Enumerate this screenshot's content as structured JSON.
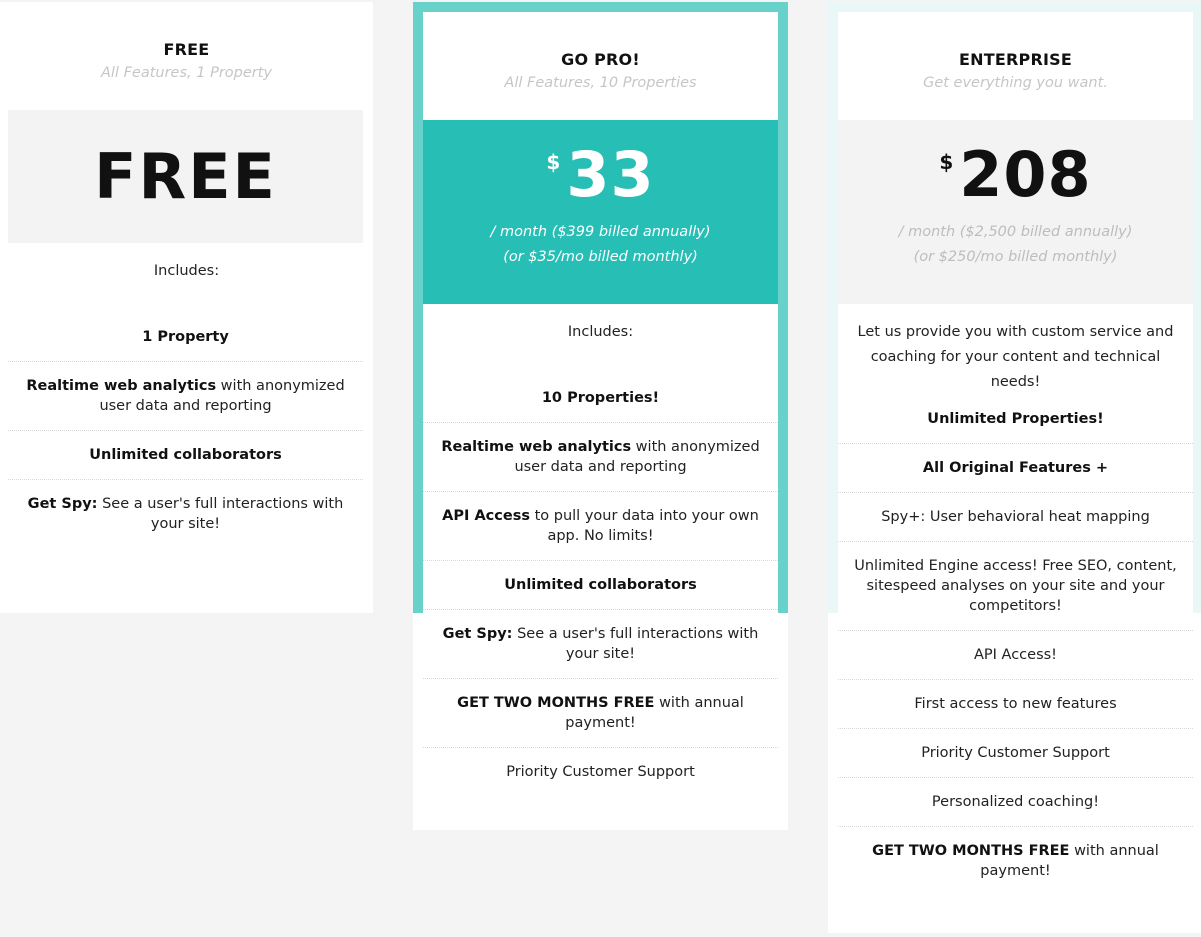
{
  "colors": {
    "page_bg": "#f4f4f4",
    "pro_accent": "#27beb5",
    "pro_border": "#67d1ca",
    "enterprise_border": "#eaf7f8",
    "price_bg": "#f3f3f3"
  },
  "plans": [
    {
      "name": "FREE",
      "tagline": "All Features, 1 Property",
      "price_label": "FREE",
      "includes_label": "Includes:",
      "features": [
        {
          "bold": "1 Property",
          "text": ""
        },
        {
          "bold": "Realtime web analytics",
          "text": " with anonymized user data and reporting"
        },
        {
          "bold": "Unlimited collaborators",
          "text": ""
        },
        {
          "bold": "Get Spy:",
          "text": " See a user's full interactions with your site!"
        }
      ]
    },
    {
      "name": "GO PRO!",
      "tagline": "All Features, 10 Properties",
      "currency": "$",
      "amount": "33",
      "billing_line1": "/ month ($399 billed annually)",
      "billing_line2": "(or $35/mo billed monthly)",
      "includes_label": "Includes:",
      "features": [
        {
          "bold": "10 Properties!",
          "text": ""
        },
        {
          "bold": "Realtime web analytics",
          "text": " with anonymized user data and reporting"
        },
        {
          "bold": "API Access",
          "text": " to pull your data into your own app. No limits!"
        },
        {
          "bold": "Unlimited collaborators",
          "text": ""
        },
        {
          "bold": "Get Spy:",
          "text": " See a user's full interactions with your site!"
        },
        {
          "bold": "GET TWO MONTHS FREE",
          "text": " with annual payment!"
        },
        {
          "bold": "",
          "text": "Priority Customer Support"
        }
      ]
    },
    {
      "name": "ENTERPRISE",
      "tagline": "Get everything you want.",
      "currency": "$",
      "amount": "208",
      "billing_line1": "/ month ($2,500 billed annually)",
      "billing_line2": "(or $250/mo billed monthly)",
      "intro": "Let us provide you with custom service and coaching for your content and technical needs!",
      "features": [
        {
          "bold": "Unlimited Properties!",
          "text": ""
        },
        {
          "bold": "All Original Features +",
          "text": ""
        },
        {
          "bold": "",
          "text": "Spy+: User behavioral heat mapping"
        },
        {
          "bold": "",
          "text": "Unlimited Engine access! Free SEO, content, sitespeed analyses on your site and your competitors!"
        },
        {
          "bold": "",
          "text": "API Access!"
        },
        {
          "bold": "",
          "text": "First access to new features"
        },
        {
          "bold": "",
          "text": "Priority Customer Support"
        },
        {
          "bold": "",
          "text": "Personalized coaching!"
        },
        {
          "bold": "GET TWO MONTHS FREE",
          "text": " with annual payment!"
        }
      ]
    }
  ]
}
